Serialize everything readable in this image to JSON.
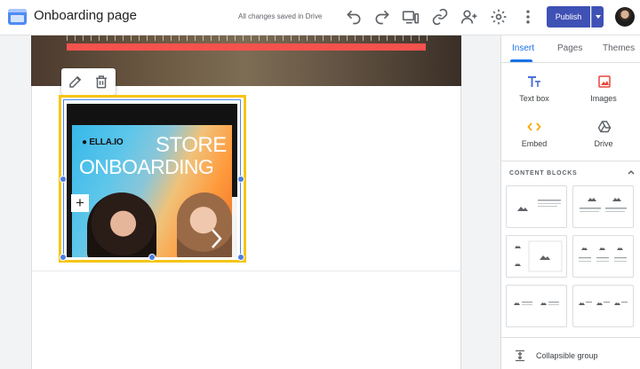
{
  "header": {
    "title": "Onboarding page",
    "save_status": "All changes saved in Drive",
    "publish_label": "Publish",
    "icons": [
      "undo-icon",
      "redo-icon",
      "preview-icon",
      "link-icon",
      "share-icon",
      "gear-icon",
      "more-vert-icon"
    ]
  },
  "image": {
    "logo_text": "ELLA.IO",
    "headline_line1": "STORE",
    "headline_line2": "ONBOARDING",
    "plus_label": "+"
  },
  "panel": {
    "tabs": [
      {
        "label": "Insert",
        "active": true
      },
      {
        "label": "Pages",
        "active": false
      },
      {
        "label": "Themes",
        "active": false
      }
    ],
    "insert_items": [
      {
        "label": "Text box",
        "icon": "text-box-icon"
      },
      {
        "label": "Images",
        "icon": "image-icon"
      },
      {
        "label": "Embed",
        "icon": "embed-icon"
      },
      {
        "label": "Drive",
        "icon": "drive-icon"
      }
    ],
    "content_blocks_title": "CONTENT BLOCKS",
    "collapsible_label": "Collapsible group"
  },
  "colors": {
    "accent": "#1a73e8",
    "publish": "#3f51b5",
    "selection": "#f5c518",
    "red_bar": "#f4524d",
    "embed_icon": "#f9ab00",
    "images_icon": "#e8453c"
  }
}
